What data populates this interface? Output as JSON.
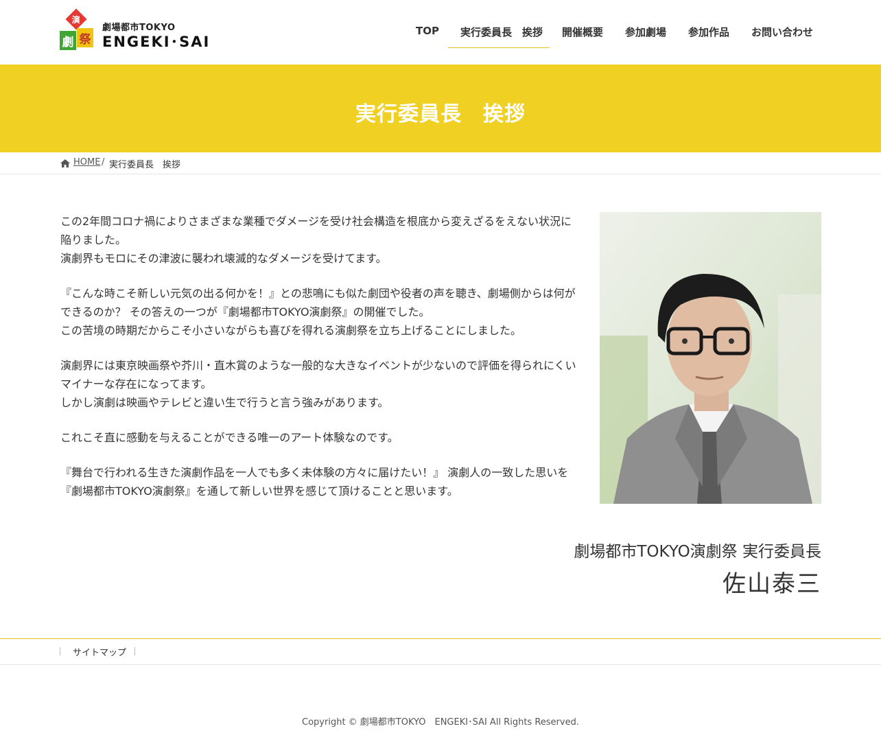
{
  "header": {
    "logo_small": "劇場都市TOKYO",
    "logo_big": "ENGEKI･SAI",
    "logo_tiles": [
      "演",
      "劇",
      "祭"
    ],
    "nav": [
      "TOP",
      "実行委員長　挨拶",
      "開催概要",
      "参加劇場",
      "参加作品",
      "お問い合わせ"
    ],
    "active_nav": "実行委員長　挨拶",
    "accent_color": "#f1d024"
  },
  "page": {
    "title": "実行委員長　挨拶"
  },
  "breadcrumb": {
    "home": "HOME",
    "separator": "/",
    "current": "実行委員長　挨拶"
  },
  "message": {
    "paragraphs": [
      [
        "この2年間コロナ禍によりさまざまな業種でダメージを受け社会構造を根底から変えざるをえない状況に",
        "陥りました。",
        "演劇界もモロにその津波に襲われ壊滅的なダメージを受けてます。"
      ],
      [
        "『こんな時こそ新しい元気の出る何かを！』との悲鳴にも似た劇団や役者の声を聴き、劇場側からは何が",
        "できるのか？ その答えの一つが『劇場都市TOKYO演劇祭』の開催でした。",
        "この苦境の時期だからこそ小さいながらも喜びを得れる演劇祭を立ち上げることにしました。"
      ],
      [
        "演劇界には東京映画祭や芥川・直木賞のような一般的な大きなイベントが少ないので評価を得られにくい",
        "マイナーな存在になってます。",
        "しかし演劇は映画やテレビと違い生で行うと言う強みがあります。"
      ],
      [
        "これこそ直に感動を与えることができる唯一のアート体験なのです。"
      ],
      [
        "『舞台で行われる生きた演劇作品を一人でも多く未体験の方々に届けたい！』 演劇人の一致した思いを",
        "『劇場都市TOKYO演劇祭』を通して新しい世界を感じて頂けることと思います。"
      ]
    ]
  },
  "signature": {
    "org": "劇場都市TOKYO演劇祭 実行委員長",
    "name": "佐山泰三"
  },
  "footer": {
    "links": [
      "サイトマップ"
    ],
    "copyright": "Copyright © 劇場都市TOKYO　ENGEKI･SAI All Rights Reserved."
  }
}
